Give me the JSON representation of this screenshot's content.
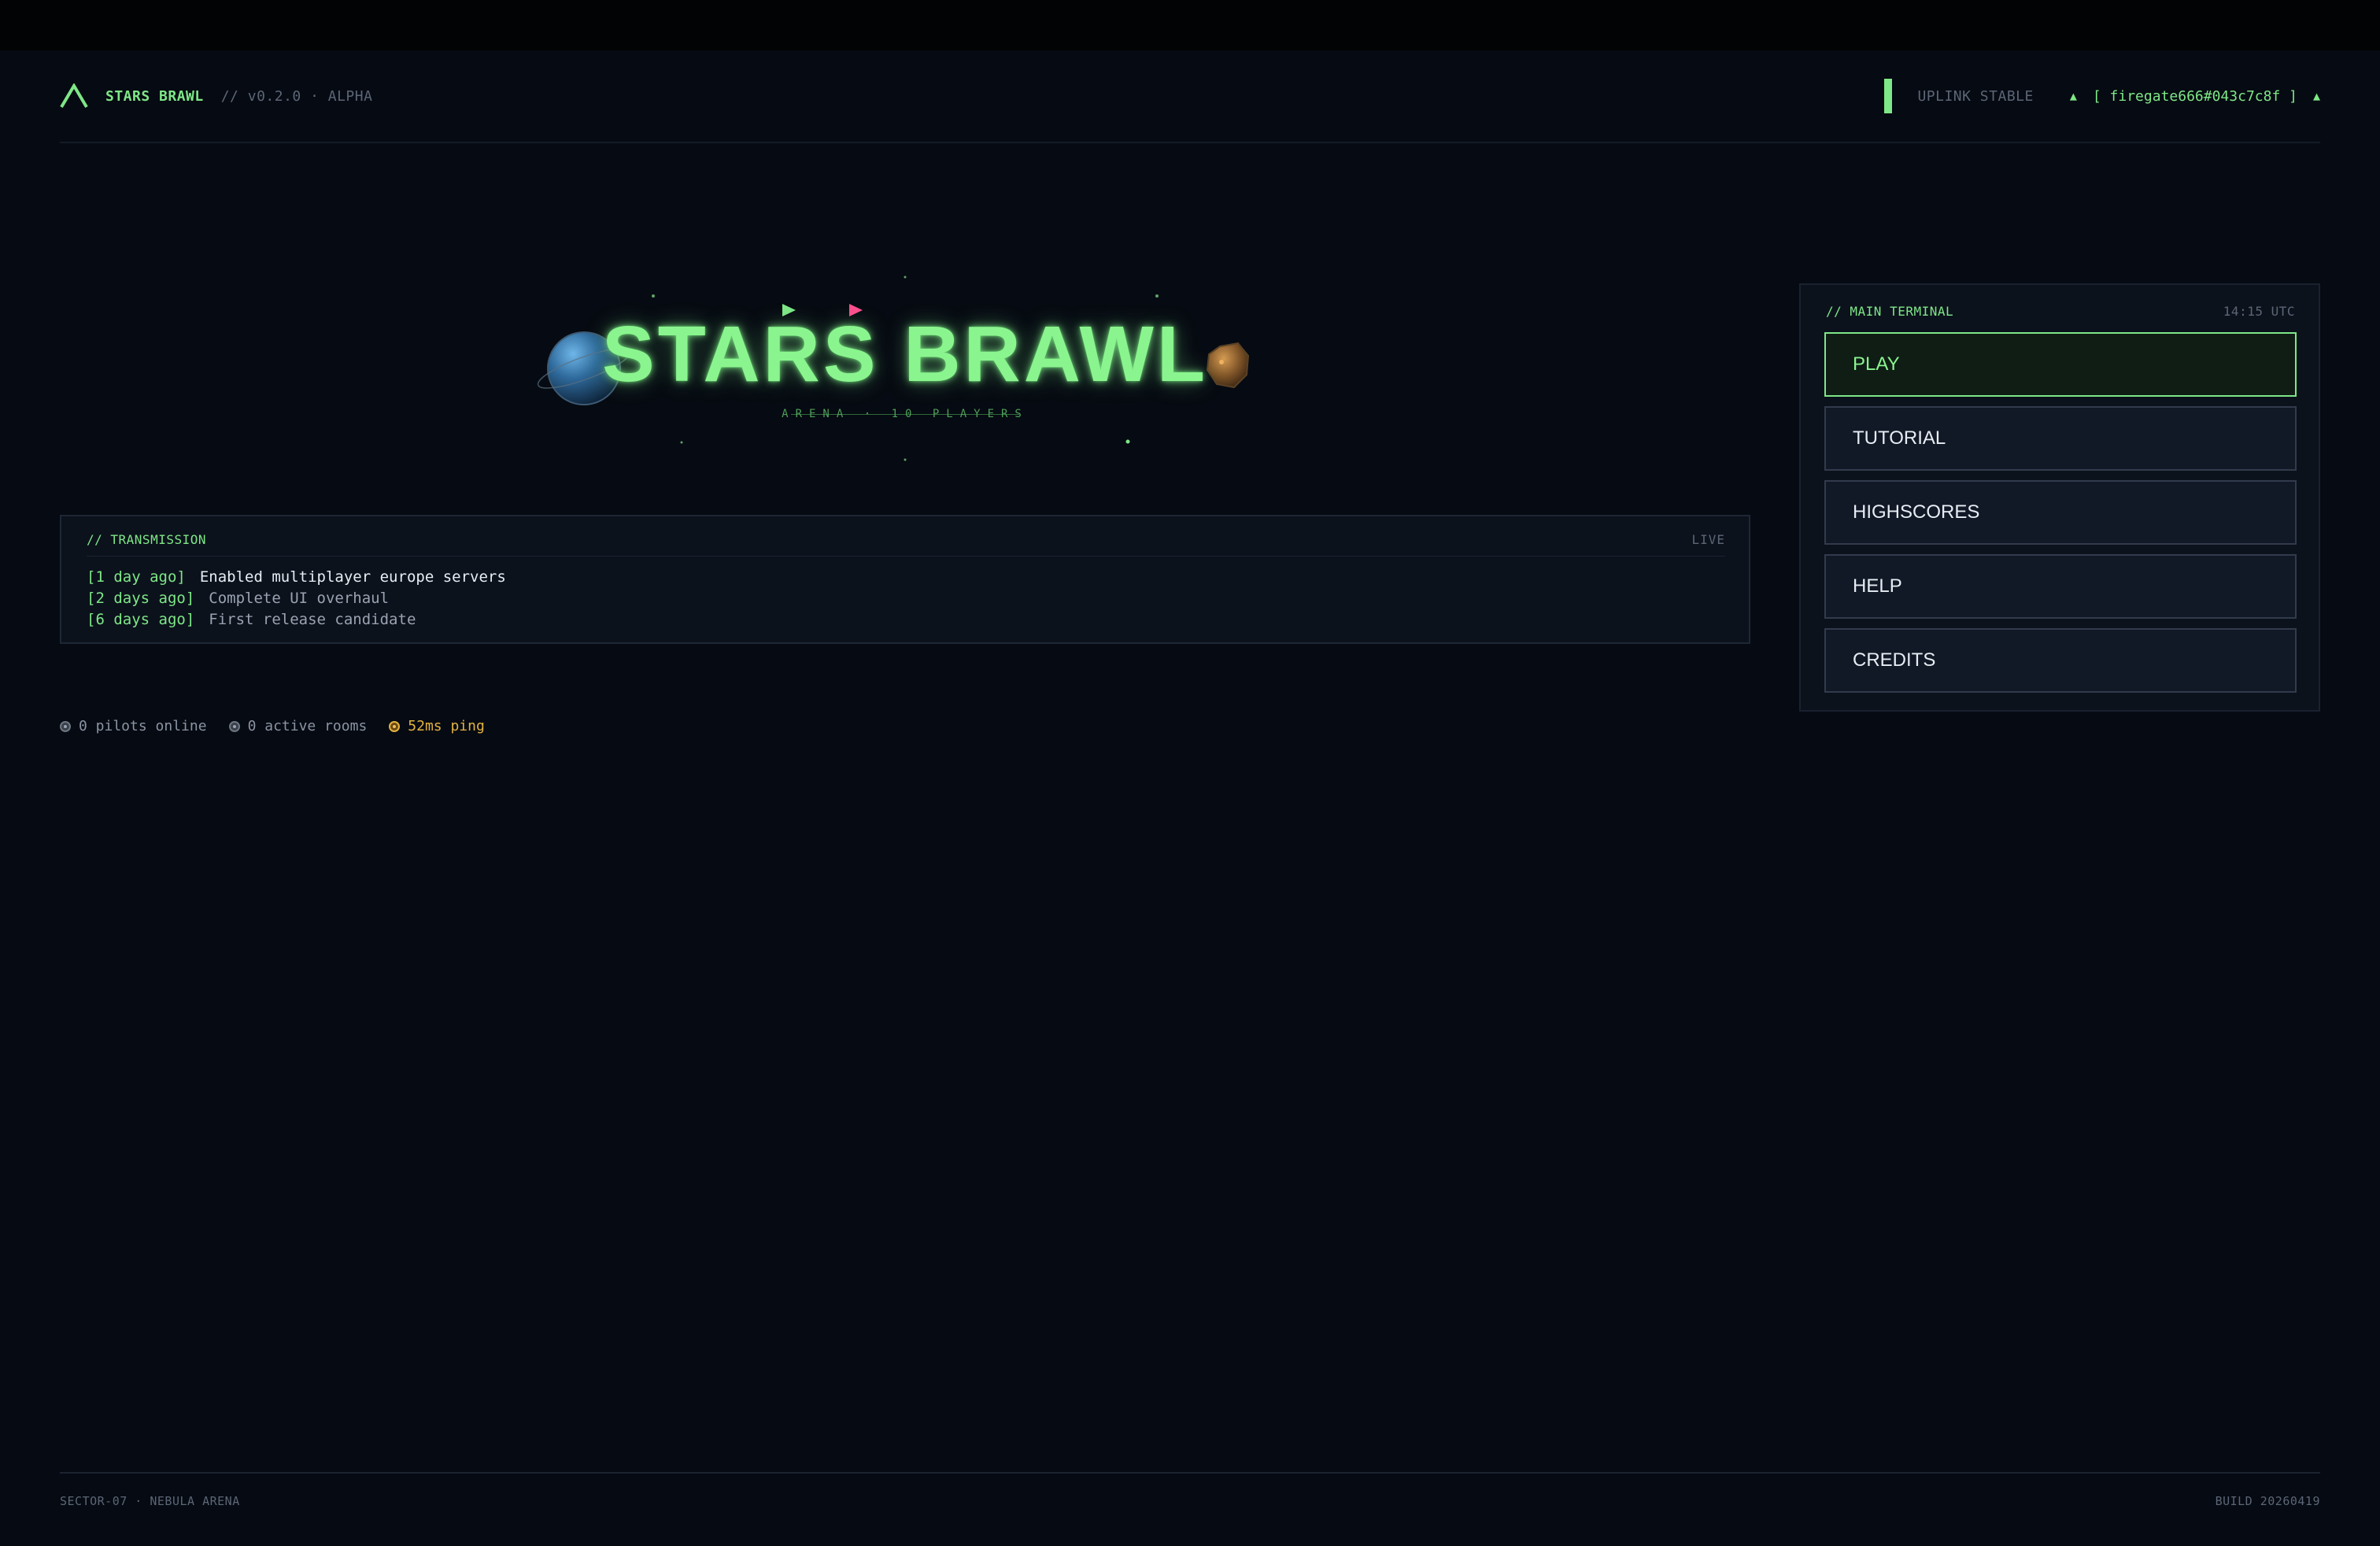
{
  "header": {
    "brand_name": "STARS BRAWL",
    "version": "// v0.2.0 · ALPHA",
    "uplink_status": "UPLINK STABLE",
    "user_tag": "[ firegate666#043c7c8f ]",
    "up_arrow": "▲"
  },
  "hero": {
    "title": "STARS BRAWL",
    "subtitle": "ARENA · 10 PLAYERS"
  },
  "transmission": {
    "label": "// TRANSMISSION",
    "status": "LIVE",
    "items": [
      {
        "time": "[1 day ago]",
        "message": "Enabled multiplayer europe servers"
      },
      {
        "time": "[2 days ago]",
        "message": "Complete UI overhaul"
      },
      {
        "time": "[6 days ago]",
        "message": "First release candidate"
      }
    ]
  },
  "stats": {
    "pilots": "0 pilots online",
    "rooms": "0 active rooms",
    "ping": "52ms ping"
  },
  "terminal": {
    "title": "// MAIN TERMINAL",
    "clock": "14:15 UTC",
    "buttons": [
      {
        "label": "PLAY",
        "active": true
      },
      {
        "label": "TUTORIAL"
      },
      {
        "label": "HIGHSCORES"
      },
      {
        "label": "HELP"
      },
      {
        "label": "CREDITS"
      }
    ]
  },
  "footer": {
    "left": "SECTOR-07 · NEBULA ARENA",
    "right": "BUILD 20260419"
  },
  "colors": {
    "accent": "#7ee787",
    "background": "#060a12",
    "panel": "#0c121c",
    "ping": "#e3b341",
    "ship_green": "#7ee787",
    "ship_pink": "#ff4d8d"
  },
  "icons": {
    "logo": "chevron-up-logo-icon",
    "planet": "planet-icon",
    "asteroid": "asteroid-icon",
    "ship": "ship-icon",
    "status_dot": "dot-icon"
  }
}
